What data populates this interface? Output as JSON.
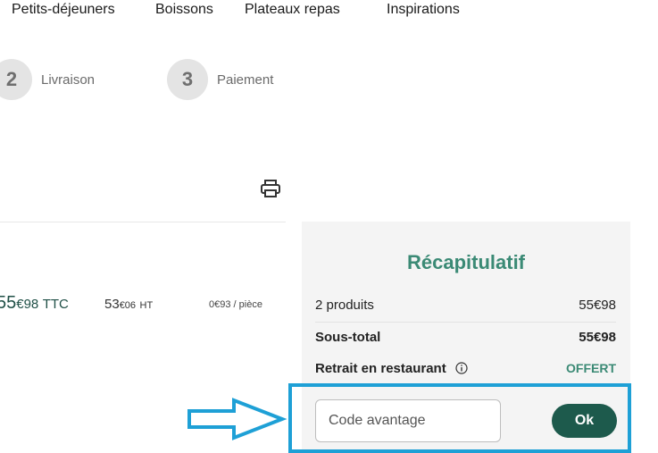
{
  "nav": {
    "items": [
      {
        "label": "Petits-déjeuners"
      },
      {
        "label": "Boissons"
      },
      {
        "label": "Plateaux repas"
      },
      {
        "label": "Inspirations"
      }
    ]
  },
  "steps": [
    {
      "number": "2",
      "label": "Livraison"
    },
    {
      "number": "3",
      "label": "Paiement"
    }
  ],
  "product": {
    "price_ttc_main": "55",
    "price_ttc_cents": "€98",
    "price_ttc_suffix": "TTC",
    "price_ht_main": "53",
    "price_ht_cents": "€06",
    "price_ht_suffix": "HT",
    "unit_price": "0€93 / pièce"
  },
  "summary": {
    "title": "Récapitulatif",
    "products_label": "2 produits",
    "products_value": "55€98",
    "subtotal_label": "Sous-total",
    "subtotal_value": "55€98",
    "pickup_label": "Retrait en restaurant",
    "pickup_value": "OFFERT",
    "code_placeholder": "Code avantage",
    "ok_label": "Ok"
  },
  "colors": {
    "accent_green": "#3b8a75",
    "button_green": "#1d5a4c",
    "highlight_blue": "#1ea0d6"
  },
  "icons": [
    "print-icon",
    "info-icon",
    "arrow-right-icon"
  ]
}
